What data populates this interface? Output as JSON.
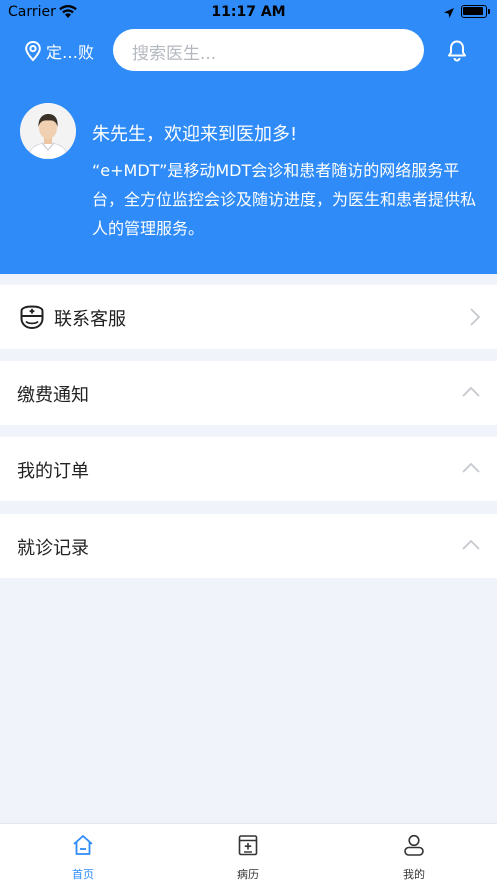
{
  "status_bar": {
    "carrier": "Carrier",
    "time": "11:17 AM"
  },
  "header": {
    "location": "定…败",
    "search_placeholder": "搜索医生...",
    "accent_color": "#2e8bf7"
  },
  "profile": {
    "welcome": "朱先生，欢迎来到医加多!",
    "description": "“e+MDT”是移动MDT会诊和患者随访的网络服务平台，全方位监控会诊及随访进度，为医生和患者提供私人的管理服务。"
  },
  "menu": {
    "contact": {
      "label": "联系客服",
      "icon": "nurse-icon"
    },
    "payment": {
      "label": "缴费通知"
    },
    "orders": {
      "label": "我的订单"
    },
    "visits": {
      "label": "就诊记录"
    }
  },
  "tabbar": {
    "home": "首页",
    "records": "病历",
    "me": "我的",
    "active_color": "#2e8bf7",
    "inactive_color": "#333333"
  }
}
